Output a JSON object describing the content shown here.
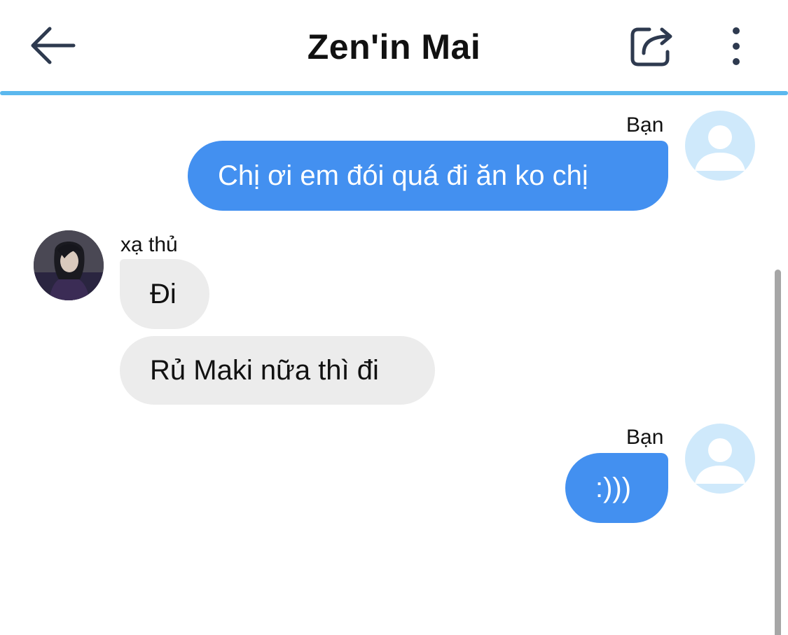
{
  "header": {
    "title": "Zen'in Mai",
    "back_icon": "arrow-left-icon",
    "share_icon": "share-icon",
    "more_icon": "vertical-ellipsis-icon",
    "divider_color": "#5bb8ee"
  },
  "colors": {
    "outgoing_bubble": "#4390f0",
    "incoming_bubble": "#ececec",
    "my_avatar_bg": "#cfe9fb"
  },
  "messages": [
    {
      "direction": "outgoing",
      "sender": "Bạn",
      "text": "Chị ơi em đói quá đi ăn ko chị"
    },
    {
      "direction": "incoming",
      "sender": "xạ thủ",
      "text": "Đi"
    },
    {
      "direction": "incoming",
      "sender": "",
      "text": "Rủ Maki nữa thì đi"
    },
    {
      "direction": "outgoing",
      "sender": "Bạn",
      "text": ":)))"
    }
  ]
}
